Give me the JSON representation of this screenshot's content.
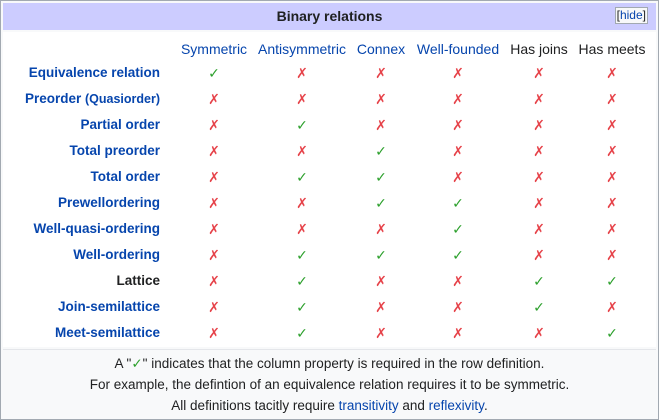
{
  "navbox": {
    "title": "Binary relations",
    "hide_open": "[",
    "hide_label": "hide",
    "hide_close": "]"
  },
  "columns": [
    {
      "label": "Symmetric",
      "link": true
    },
    {
      "label": "Antisymmetric",
      "link": true
    },
    {
      "label": "Connex",
      "link": true
    },
    {
      "label": "Well-founded",
      "link": true
    },
    {
      "label": "Has joins",
      "link": false
    },
    {
      "label": "Has meets",
      "link": false
    }
  ],
  "rows": [
    {
      "label": "Equivalence relation",
      "sub": "",
      "link": true,
      "cells": [
        true,
        false,
        false,
        false,
        false,
        false
      ]
    },
    {
      "label": "Preorder",
      "sub": "(Quasiorder)",
      "link": true,
      "cells": [
        false,
        false,
        false,
        false,
        false,
        false
      ]
    },
    {
      "label": "Partial order",
      "sub": "",
      "link": true,
      "cells": [
        false,
        true,
        false,
        false,
        false,
        false
      ]
    },
    {
      "label": "Total preorder",
      "sub": "",
      "link": true,
      "cells": [
        false,
        false,
        true,
        false,
        false,
        false
      ]
    },
    {
      "label": "Total order",
      "sub": "",
      "link": true,
      "cells": [
        false,
        true,
        true,
        false,
        false,
        false
      ]
    },
    {
      "label": "Prewellordering",
      "sub": "",
      "link": true,
      "cells": [
        false,
        false,
        true,
        true,
        false,
        false
      ]
    },
    {
      "label": "Well-quasi-ordering",
      "sub": "",
      "link": true,
      "cells": [
        false,
        false,
        false,
        true,
        false,
        false
      ]
    },
    {
      "label": "Well-ordering",
      "sub": "",
      "link": true,
      "cells": [
        false,
        true,
        true,
        true,
        false,
        false
      ]
    },
    {
      "label": "Lattice",
      "sub": "",
      "link": false,
      "cells": [
        false,
        true,
        false,
        false,
        true,
        true
      ]
    },
    {
      "label": "Join-semilattice",
      "sub": "",
      "link": true,
      "cells": [
        false,
        true,
        false,
        false,
        true,
        false
      ]
    },
    {
      "label": "Meet-semilattice",
      "sub": "",
      "link": true,
      "cells": [
        false,
        true,
        false,
        false,
        false,
        true
      ]
    }
  ],
  "symbols": {
    "yes": "✓",
    "no": "✗"
  },
  "footer": {
    "line1_pre": "A \"",
    "line1_check": "✓",
    "line1_post": "\" indicates that the column property is required in the row definition.",
    "line2": "For example, the defintion of an equivalence relation requires it to be symmetric.",
    "line3_pre": "All definitions tacitly require ",
    "line3_link1": "transitivity",
    "line3_mid": " and ",
    "line3_link2": "reflexivity",
    "line3_post": "."
  },
  "colors": {
    "title_bar": "#ccccff",
    "link": "#0645ad",
    "yes": "#2ca02c",
    "no": "#e6434a"
  }
}
